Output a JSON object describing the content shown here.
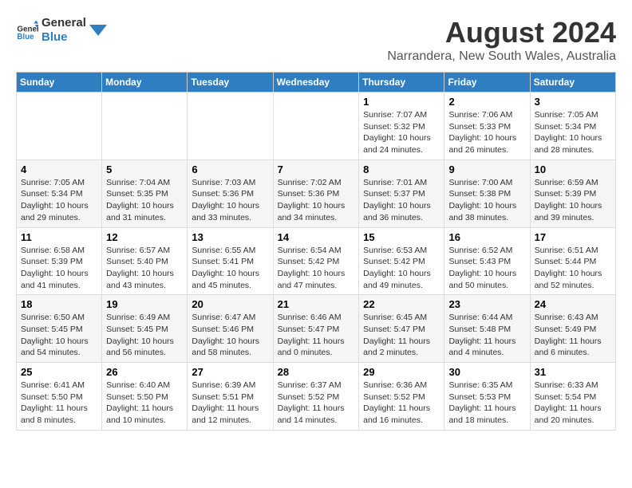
{
  "header": {
    "logo_line1": "General",
    "logo_line2": "Blue",
    "month_year": "August 2024",
    "location": "Narrandera, New South Wales, Australia"
  },
  "weekdays": [
    "Sunday",
    "Monday",
    "Tuesday",
    "Wednesday",
    "Thursday",
    "Friday",
    "Saturday"
  ],
  "weeks": [
    [
      {
        "day": "",
        "info": ""
      },
      {
        "day": "",
        "info": ""
      },
      {
        "day": "",
        "info": ""
      },
      {
        "day": "",
        "info": ""
      },
      {
        "day": "1",
        "info": "Sunrise: 7:07 AM\nSunset: 5:32 PM\nDaylight: 10 hours\nand 24 minutes."
      },
      {
        "day": "2",
        "info": "Sunrise: 7:06 AM\nSunset: 5:33 PM\nDaylight: 10 hours\nand 26 minutes."
      },
      {
        "day": "3",
        "info": "Sunrise: 7:05 AM\nSunset: 5:34 PM\nDaylight: 10 hours\nand 28 minutes."
      }
    ],
    [
      {
        "day": "4",
        "info": "Sunrise: 7:05 AM\nSunset: 5:34 PM\nDaylight: 10 hours\nand 29 minutes."
      },
      {
        "day": "5",
        "info": "Sunrise: 7:04 AM\nSunset: 5:35 PM\nDaylight: 10 hours\nand 31 minutes."
      },
      {
        "day": "6",
        "info": "Sunrise: 7:03 AM\nSunset: 5:36 PM\nDaylight: 10 hours\nand 33 minutes."
      },
      {
        "day": "7",
        "info": "Sunrise: 7:02 AM\nSunset: 5:36 PM\nDaylight: 10 hours\nand 34 minutes."
      },
      {
        "day": "8",
        "info": "Sunrise: 7:01 AM\nSunset: 5:37 PM\nDaylight: 10 hours\nand 36 minutes."
      },
      {
        "day": "9",
        "info": "Sunrise: 7:00 AM\nSunset: 5:38 PM\nDaylight: 10 hours\nand 38 minutes."
      },
      {
        "day": "10",
        "info": "Sunrise: 6:59 AM\nSunset: 5:39 PM\nDaylight: 10 hours\nand 39 minutes."
      }
    ],
    [
      {
        "day": "11",
        "info": "Sunrise: 6:58 AM\nSunset: 5:39 PM\nDaylight: 10 hours\nand 41 minutes."
      },
      {
        "day": "12",
        "info": "Sunrise: 6:57 AM\nSunset: 5:40 PM\nDaylight: 10 hours\nand 43 minutes."
      },
      {
        "day": "13",
        "info": "Sunrise: 6:55 AM\nSunset: 5:41 PM\nDaylight: 10 hours\nand 45 minutes."
      },
      {
        "day": "14",
        "info": "Sunrise: 6:54 AM\nSunset: 5:42 PM\nDaylight: 10 hours\nand 47 minutes."
      },
      {
        "day": "15",
        "info": "Sunrise: 6:53 AM\nSunset: 5:42 PM\nDaylight: 10 hours\nand 49 minutes."
      },
      {
        "day": "16",
        "info": "Sunrise: 6:52 AM\nSunset: 5:43 PM\nDaylight: 10 hours\nand 50 minutes."
      },
      {
        "day": "17",
        "info": "Sunrise: 6:51 AM\nSunset: 5:44 PM\nDaylight: 10 hours\nand 52 minutes."
      }
    ],
    [
      {
        "day": "18",
        "info": "Sunrise: 6:50 AM\nSunset: 5:45 PM\nDaylight: 10 hours\nand 54 minutes."
      },
      {
        "day": "19",
        "info": "Sunrise: 6:49 AM\nSunset: 5:45 PM\nDaylight: 10 hours\nand 56 minutes."
      },
      {
        "day": "20",
        "info": "Sunrise: 6:47 AM\nSunset: 5:46 PM\nDaylight: 10 hours\nand 58 minutes."
      },
      {
        "day": "21",
        "info": "Sunrise: 6:46 AM\nSunset: 5:47 PM\nDaylight: 11 hours\nand 0 minutes."
      },
      {
        "day": "22",
        "info": "Sunrise: 6:45 AM\nSunset: 5:47 PM\nDaylight: 11 hours\nand 2 minutes."
      },
      {
        "day": "23",
        "info": "Sunrise: 6:44 AM\nSunset: 5:48 PM\nDaylight: 11 hours\nand 4 minutes."
      },
      {
        "day": "24",
        "info": "Sunrise: 6:43 AM\nSunset: 5:49 PM\nDaylight: 11 hours\nand 6 minutes."
      }
    ],
    [
      {
        "day": "25",
        "info": "Sunrise: 6:41 AM\nSunset: 5:50 PM\nDaylight: 11 hours\nand 8 minutes."
      },
      {
        "day": "26",
        "info": "Sunrise: 6:40 AM\nSunset: 5:50 PM\nDaylight: 11 hours\nand 10 minutes."
      },
      {
        "day": "27",
        "info": "Sunrise: 6:39 AM\nSunset: 5:51 PM\nDaylight: 11 hours\nand 12 minutes."
      },
      {
        "day": "28",
        "info": "Sunrise: 6:37 AM\nSunset: 5:52 PM\nDaylight: 11 hours\nand 14 minutes."
      },
      {
        "day": "29",
        "info": "Sunrise: 6:36 AM\nSunset: 5:52 PM\nDaylight: 11 hours\nand 16 minutes."
      },
      {
        "day": "30",
        "info": "Sunrise: 6:35 AM\nSunset: 5:53 PM\nDaylight: 11 hours\nand 18 minutes."
      },
      {
        "day": "31",
        "info": "Sunrise: 6:33 AM\nSunset: 5:54 PM\nDaylight: 11 hours\nand 20 minutes."
      }
    ]
  ]
}
